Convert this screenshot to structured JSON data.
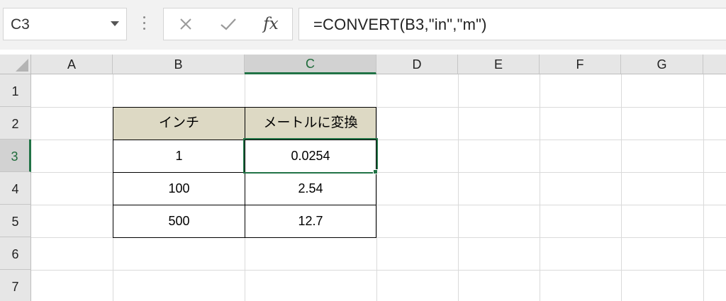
{
  "name_box": {
    "value": "C3"
  },
  "formula_bar": {
    "cancel_icon": "close-icon",
    "enter_icon": "check-icon",
    "fx_label": "fx",
    "formula": "=CONVERT(B3,\"in\",\"m\")"
  },
  "columns": [
    "A",
    "B",
    "C",
    "D",
    "E",
    "F",
    "G"
  ],
  "rows": [
    "1",
    "2",
    "3",
    "4",
    "5",
    "6",
    "7"
  ],
  "selected_cell": "C3",
  "table": {
    "headers": {
      "b": "インチ",
      "c": "メートルに変換"
    },
    "rows": [
      {
        "b": "1",
        "c": "0.0254"
      },
      {
        "b": "100",
        "c": "2.54"
      },
      {
        "b": "500",
        "c": "12.7"
      }
    ]
  },
  "colors": {
    "accent": "#217346",
    "header_fill": "#ddd9c4"
  }
}
